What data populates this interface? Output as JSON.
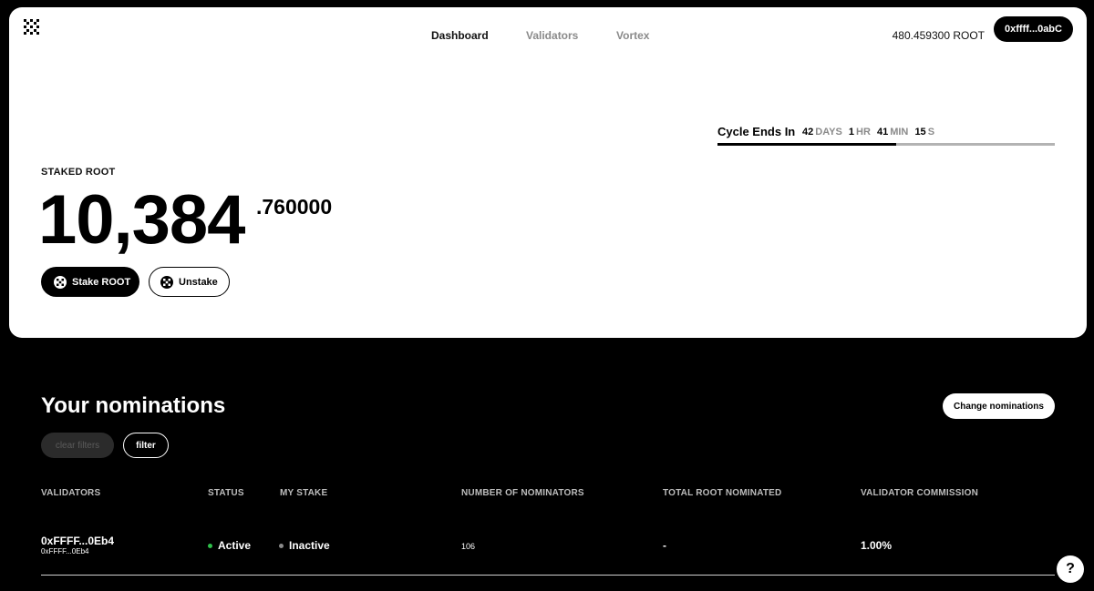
{
  "nav": {
    "items": [
      "Dashboard",
      "Validators",
      "Vortex"
    ],
    "active": "Dashboard"
  },
  "header": {
    "balance": "480.459300 ROOT",
    "wallet": "0xffff...0abC"
  },
  "cycle": {
    "label": "Cycle Ends In",
    "days": "42",
    "days_unit": "DAYS",
    "hours": "1",
    "hours_unit": "HR",
    "minutes": "41",
    "minutes_unit": "MIN",
    "seconds": "15",
    "seconds_unit": "S",
    "progress": 0.53
  },
  "staked": {
    "label": "STAKED ROOT",
    "integer": "10,384",
    "decimal": ".760000",
    "stake_button": "Stake ROOT",
    "unstake_button": "Unstake"
  },
  "nominations": {
    "title": "Your nominations",
    "change_button": "Change nominations",
    "clear_filters": "clear filters",
    "filter": "filter",
    "columns": {
      "validators": "VALIDATORS",
      "status": "STATUS",
      "my_stake": "MY STAKE",
      "nominators": "NUMBER OF NOMINATORS",
      "total": "TOTAL ROOT NOMINATED",
      "commission": "VALIDATOR COMMISSION"
    },
    "rows": [
      {
        "validator": "0xFFFF...0Eb4",
        "validator_sub": "0xFFFF...0Eb4",
        "status": "Active",
        "my_stake": "Inactive",
        "nominators": "106",
        "total": "-",
        "commission": "1.00%"
      }
    ]
  },
  "help": {
    "label": "?"
  },
  "colors": {
    "active_dot": "#2fbf4a",
    "inactive_dot": "#8a8a8a"
  }
}
